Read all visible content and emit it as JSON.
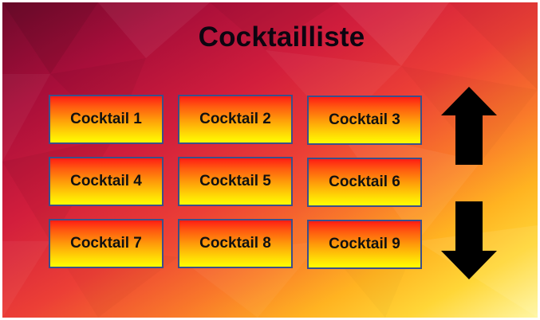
{
  "title": "Cocktailliste",
  "cocktails": [
    {
      "label": "Cocktail 1"
    },
    {
      "label": "Cocktail 2"
    },
    {
      "label": "Cocktail 3"
    },
    {
      "label": "Cocktail 4"
    },
    {
      "label": "Cocktail 5"
    },
    {
      "label": "Cocktail 6"
    },
    {
      "label": "Cocktail 7"
    },
    {
      "label": "Cocktail 8"
    },
    {
      "label": "Cocktail 9"
    }
  ],
  "navigation": {
    "up_icon": "arrow-up-icon",
    "down_icon": "arrow-down-icon"
  },
  "colors": {
    "tile_border": "#3b4f8a",
    "tile_top": "#ff1d14",
    "tile_bottom": "#ffff00",
    "arrow": "#000000",
    "title_text": "#0c0510"
  }
}
